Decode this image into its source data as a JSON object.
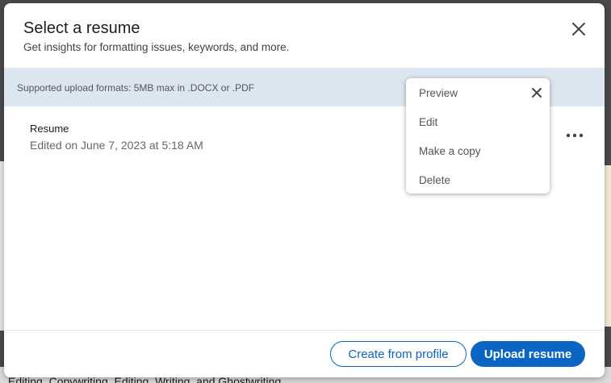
{
  "modal": {
    "title": "Select a resume",
    "subtitle": "Get insights for formatting issues, keywords, and more.",
    "close_icon": "close-icon"
  },
  "info_bar": {
    "text": "Supported upload formats: 5MB max in .DOCX or .PDF"
  },
  "resume": {
    "name": "Resume",
    "edited": "Edited on June 7, 2023 at 5:18 AM",
    "more_icon": "more-horizontal-icon"
  },
  "menu": {
    "items": [
      "Preview",
      "Edit",
      "Make a copy",
      "Delete"
    ],
    "close_icon": "close-icon"
  },
  "footer": {
    "create_label": "Create from profile",
    "upload_label": "Upload resume"
  },
  "background": {
    "bottom_text": "Editing, Copywriting, Editing, Writing, and Ghostwriting"
  },
  "colors": {
    "accent": "#0a66c2",
    "info_bar": "#dce6f1"
  }
}
